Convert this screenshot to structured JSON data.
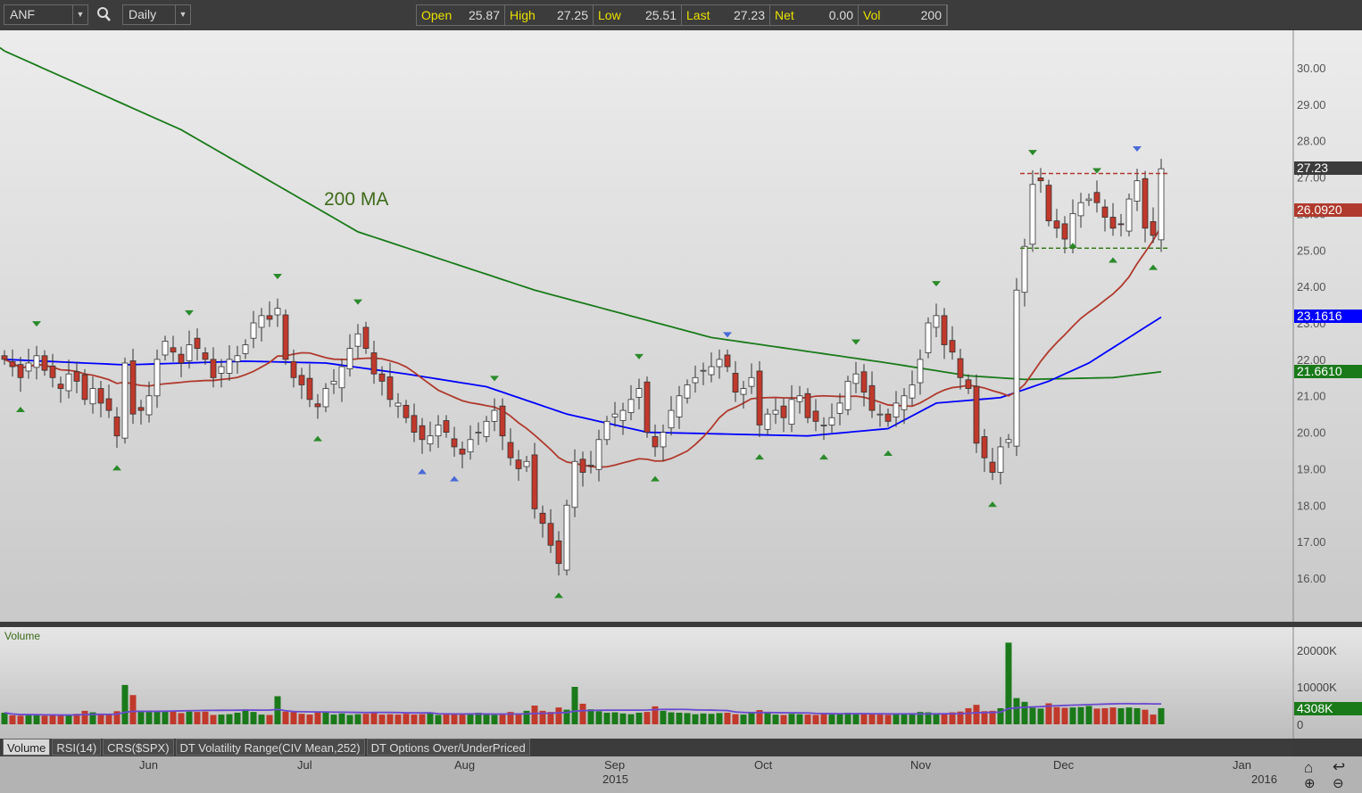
{
  "toolbar": {
    "symbol": "ANF",
    "interval": "Daily",
    "search_icon": "search-icon"
  },
  "quote": [
    {
      "label": "Open",
      "value": "25.87"
    },
    {
      "label": "High",
      "value": "27.25"
    },
    {
      "label": "Low",
      "value": "25.51"
    },
    {
      "label": "Last",
      "value": "27.23"
    },
    {
      "label": "Net",
      "value": "0.00"
    },
    {
      "label": "Vol",
      "value": "200"
    }
  ],
  "price_axis": [
    "30.00",
    "29.00",
    "28.00",
    "27.00",
    "26.00",
    "25.00",
    "24.00",
    "23.00",
    "22.00",
    "21.00",
    "20.00",
    "19.00",
    "18.00",
    "17.00",
    "16.00"
  ],
  "tags": {
    "last": "27.23",
    "ma20": "26.0920",
    "ma50": "23.1616",
    "ma200": "21.6610"
  },
  "colors": {
    "last": "#3c3c3c",
    "ma20": "#b03a2e",
    "ma50": "#0000ff",
    "ma200": "#1a7a1a",
    "up": "#1a7a1a",
    "down": "#c0392b"
  },
  "annotation": "200 MA",
  "volume_panel": {
    "title": "Volume",
    "axis": [
      "20000K",
      "10000K",
      "0"
    ],
    "tag": "4308K"
  },
  "tabs": [
    "Volume",
    "RSI(14)",
    "CRS($SPX)",
    "DT Volatility Range(CIV Mean,252)",
    "DT Options Over/UnderPriced"
  ],
  "dates": {
    "months": [
      "Jun",
      "Jul",
      "Aug",
      "Sep",
      "Oct",
      "Nov",
      "Dec",
      "Jan"
    ],
    "years": [
      "2015",
      "2016"
    ]
  },
  "chart_data": {
    "type": "candlestick",
    "symbol": "ANF",
    "interval": "Daily",
    "ylim": [
      15,
      31
    ],
    "close": [
      22.0,
      21.8,
      21.5,
      21.9,
      22.1,
      21.7,
      21.5,
      21.2,
      21.6,
      21.4,
      20.9,
      21.2,
      20.8,
      20.6,
      19.9,
      21.9,
      20.5,
      20.6,
      21.0,
      22.0,
      22.5,
      22.2,
      21.9,
      22.4,
      22.3,
      22.0,
      21.5,
      21.8,
      22.0,
      22.1,
      22.4,
      23.0,
      23.2,
      23.1,
      23.4,
      22.0,
      21.5,
      21.3,
      20.9,
      20.7,
      21.2,
      21.4,
      21.8,
      22.3,
      22.7,
      22.3,
      21.6,
      21.4,
      20.9,
      20.8,
      20.4,
      20.0,
      19.8,
      19.9,
      20.2,
      20.0,
      19.6,
      19.4,
      19.8,
      20.0,
      20.3,
      20.6,
      19.9,
      19.3,
      19.0,
      19.2,
      17.9,
      17.5,
      16.9,
      16.4,
      18.0,
      19.2,
      18.9,
      19.1,
      19.8,
      20.3,
      20.5,
      20.6,
      20.9,
      21.2,
      20.0,
      19.6,
      20.0,
      20.6,
      21.0,
      21.3,
      21.5,
      21.7,
      21.8,
      22.0,
      21.8,
      21.1,
      21.2,
      21.5,
      20.2,
      20.5,
      20.6,
      20.4,
      20.9,
      21.0,
      20.4,
      20.3,
      20.2,
      20.4,
      20.8,
      21.4,
      21.6,
      21.1,
      20.6,
      20.5,
      20.3,
      20.8,
      21.0,
      21.3,
      22.0,
      23.0,
      23.2,
      22.4,
      22.2,
      21.5,
      21.2,
      19.7,
      19.3,
      18.9,
      19.6,
      19.8,
      23.9,
      25.1,
      26.8,
      26.9,
      25.8,
      25.6,
      25.3,
      26.0,
      26.3,
      26.4,
      26.3,
      25.9,
      25.6,
      25.7,
      26.4,
      26.9,
      25.6,
      25.4,
      27.23
    ],
    "volume_k": [
      3100,
      2400,
      2300,
      2600,
      2500,
      2300,
      2400,
      2300,
      2500,
      2800,
      3600,
      3200,
      2700,
      2500,
      3500,
      10500,
      7800,
      3500,
      3300,
      3600,
      3600,
      3500,
      3000,
      3400,
      3300,
      3400,
      2500,
      2600,
      2700,
      3100,
      4000,
      3300,
      2600,
      2500,
      7500,
      3400,
      3300,
      2800,
      2600,
      3100,
      3300,
      2600,
      2900,
      2500,
      2700,
      2800,
      3000,
      2600,
      2700,
      2600,
      2800,
      2600,
      2700,
      3000,
      2500,
      2800,
      2800,
      2900,
      2700,
      3100,
      2700,
      2500,
      2600,
      3300,
      2600,
      3600,
      5000,
      3600,
      3300,
      4500,
      3900,
      10000,
      5500,
      4000,
      3500,
      3100,
      3200,
      2900,
      2700,
      3100,
      3300,
      4800,
      3600,
      3200,
      3100,
      3000,
      2700,
      2900,
      2800,
      3000,
      3100,
      2700,
      2600,
      3200,
      3800,
      3000,
      2600,
      2500,
      2800,
      2700,
      2600,
      2500,
      2700,
      2600,
      2800,
      3100,
      2900,
      2800,
      2700,
      2600,
      2500,
      2700,
      2800,
      3000,
      3300,
      3200,
      3000,
      2900,
      3200,
      3400,
      4300,
      5200,
      3500,
      3600,
      4300,
      21800,
      7000,
      6000,
      4400,
      4200,
      5600,
      4600,
      4400,
      4500,
      4600,
      4900,
      4200,
      4300,
      4500,
      4300,
      4500,
      4300,
      3900,
      2600,
      4308
    ],
    "ma200_points": [
      [
        0,
        30.46
      ],
      [
        22,
        28.3
      ],
      [
        44,
        25.5
      ],
      [
        66,
        23.9
      ],
      [
        88,
        22.6
      ],
      [
        110,
        21.9
      ],
      [
        120,
        21.55
      ],
      [
        127,
        21.45
      ],
      [
        138,
        21.5
      ],
      [
        144,
        21.66
      ]
    ],
    "ma50_points": [
      [
        0,
        22.0
      ],
      [
        15,
        21.85
      ],
      [
        30,
        21.95
      ],
      [
        40,
        21.9
      ],
      [
        50,
        21.6
      ],
      [
        60,
        21.25
      ],
      [
        70,
        20.5
      ],
      [
        80,
        20.0
      ],
      [
        90,
        19.95
      ],
      [
        100,
        19.9
      ],
      [
        110,
        20.1
      ],
      [
        116,
        20.8
      ],
      [
        124,
        20.95
      ],
      [
        130,
        21.4
      ],
      [
        135,
        21.9
      ],
      [
        140,
        22.6
      ],
      [
        144,
        23.16
      ]
    ],
    "pivots": [
      {
        "day": 4,
        "type": "high"
      },
      {
        "day": 2,
        "type": "low"
      },
      {
        "day": 14,
        "type": "low"
      },
      {
        "day": 23,
        "type": "high"
      },
      {
        "day": 34,
        "type": "high"
      },
      {
        "day": 39,
        "type": "low"
      },
      {
        "day": 44,
        "type": "high"
      },
      {
        "day": 52,
        "type": "low"
      },
      {
        "day": 56,
        "type": "low"
      },
      {
        "day": 61,
        "type": "high"
      },
      {
        "day": 69,
        "type": "low"
      },
      {
        "day": 79,
        "type": "high"
      },
      {
        "day": 81,
        "type": "low"
      },
      {
        "day": 90,
        "type": "high"
      },
      {
        "day": 94,
        "type": "low"
      },
      {
        "day": 102,
        "type": "low"
      },
      {
        "day": 106,
        "type": "high"
      },
      {
        "day": 110,
        "type": "low"
      },
      {
        "day": 116,
        "type": "high"
      },
      {
        "day": 123,
        "type": "low"
      },
      {
        "day": 128,
        "type": "high"
      },
      {
        "day": 133,
        "type": "low"
      },
      {
        "day": 136,
        "type": "high"
      },
      {
        "day": 138,
        "type": "low"
      },
      {
        "day": 141,
        "type": "high"
      },
      {
        "day": 143,
        "type": "low"
      }
    ],
    "resistance": 27.1,
    "support": 25.05
  }
}
